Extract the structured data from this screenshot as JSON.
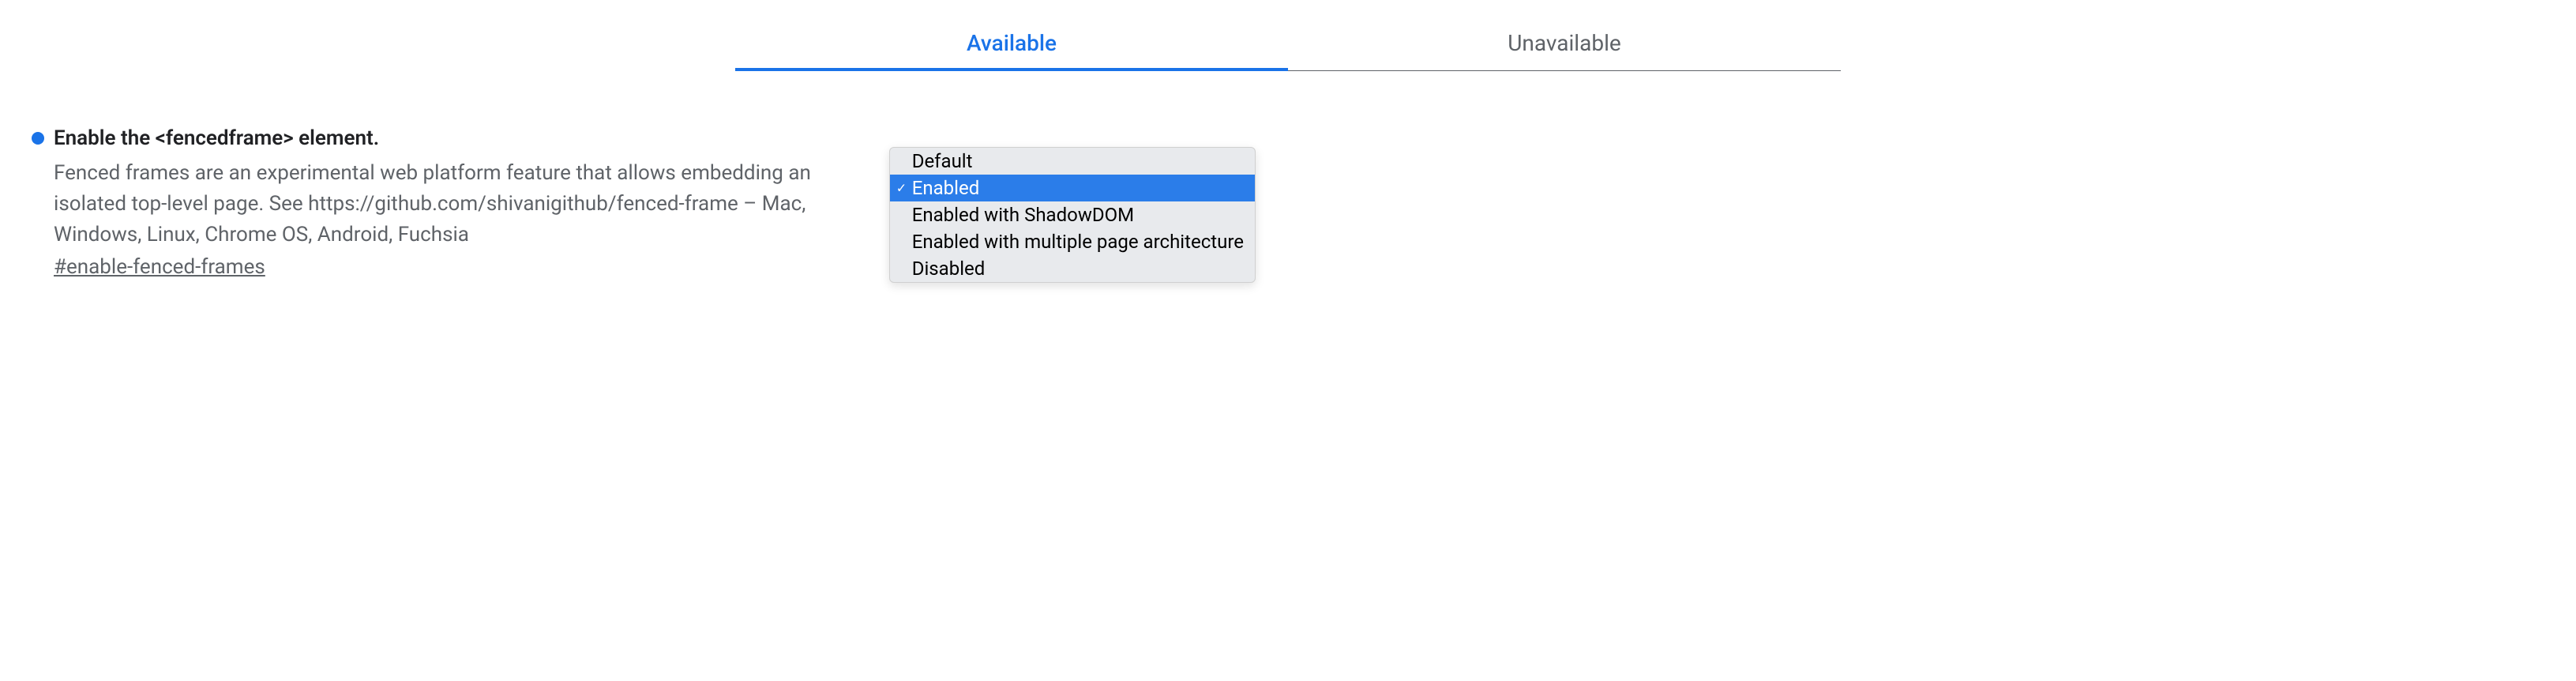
{
  "tabs": {
    "available": "Available",
    "unavailable": "Unavailable"
  },
  "flag": {
    "title": "Enable the <fencedframe> element.",
    "description": "Fenced frames are an experimental web platform feature that allows embedding an isolated top-level page. See https://github.com/shivanigithub/fenced-frame – Mac, Windows, Linux, Chrome OS, Android, Fuchsia",
    "hash": "#enable-fenced-frames"
  },
  "dropdown": {
    "options": [
      "Default",
      "Enabled",
      "Enabled with ShadowDOM",
      "Enabled with multiple page architecture",
      "Disabled"
    ],
    "selected_index": 1
  }
}
